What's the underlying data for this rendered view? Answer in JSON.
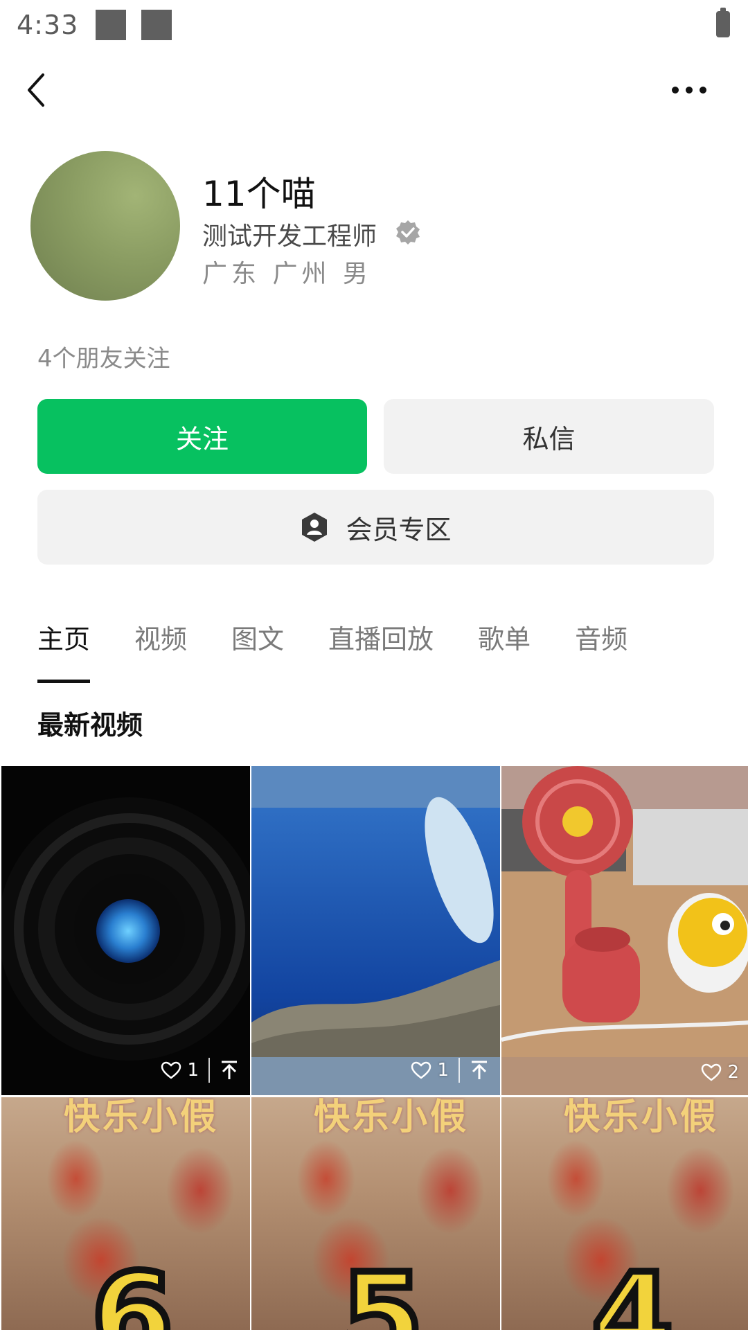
{
  "status_bar": {
    "time": "4:33"
  },
  "profile": {
    "name": "11个喵",
    "title": "测试开发工程师",
    "location": "广东 广州 男",
    "friends_follow": "4个朋友关注"
  },
  "actions": {
    "follow": "关注",
    "message": "私信",
    "member_zone": "会员专区"
  },
  "tabs": [
    {
      "label": "主页",
      "active": true
    },
    {
      "label": "视频",
      "active": false
    },
    {
      "label": "图文",
      "active": false
    },
    {
      "label": "直播回放",
      "active": false
    },
    {
      "label": "歌单",
      "active": false
    },
    {
      "label": "音频",
      "active": false
    }
  ],
  "section_title": "最新视频",
  "videos": [
    {
      "likes": "1",
      "pinned": true
    },
    {
      "likes": "1",
      "pinned": true
    },
    {
      "likes": "2",
      "pinned": false
    },
    {
      "banner": "快乐小假",
      "number": "6"
    },
    {
      "banner": "快乐小假",
      "number": "5"
    },
    {
      "banner": "快乐小假",
      "number": "4"
    }
  ],
  "colors": {
    "accent": "#07c160",
    "button_gray": "#f2f2f2"
  },
  "icons": [
    "back-arrow-icon",
    "more-dots-icon",
    "verified-badge-icon",
    "member-shield-icon",
    "heart-icon",
    "pin-top-icon"
  ]
}
